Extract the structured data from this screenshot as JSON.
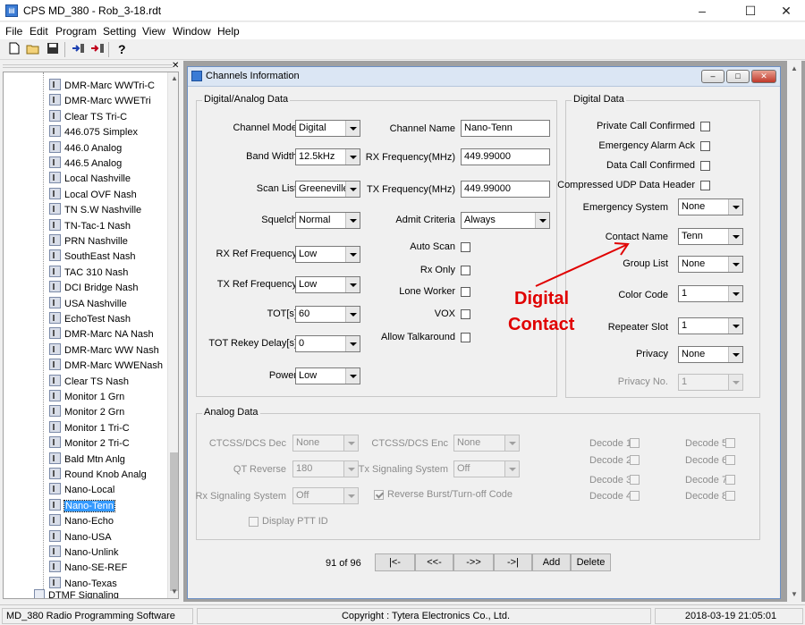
{
  "window": {
    "title": "CPS MD_380 - Rob_3-18.rdt",
    "icon": "cps-app-icon"
  },
  "menu": [
    "File",
    "Edit",
    "Program",
    "Setting",
    "View",
    "Window",
    "Help"
  ],
  "toolbar": {
    "icons": [
      "new-file-icon",
      "open-folder-icon",
      "save-icon",
      "read-radio-icon",
      "write-radio-icon",
      "help-icon"
    ]
  },
  "tree": {
    "items": [
      "DMR-Marc WWTri-C",
      "DMR-Marc WWETri",
      "Clear TS Tri-C",
      "446.075 Simplex",
      "446.0 Analog",
      "446.5 Analog",
      "Local Nashville",
      "Local OVF Nash",
      "TN S.W Nashville",
      "TN-Tac-1 Nash",
      "PRN Nashville",
      "SouthEast Nash",
      "TAC 310 Nash",
      "DCI Bridge Nash",
      "USA Nashville",
      "EchoTest Nash",
      "DMR-Marc NA Nash",
      "DMR-Marc WW Nash",
      "DMR-Marc WWENash",
      "Clear TS Nash",
      "Monitor 1 Grn",
      "Monitor 2 Grn",
      "Monitor 1 Tri-C",
      "Monitor 2 Tri-C",
      "Bald Mtn Anlg",
      "Round Knob Analg",
      "Nano-Local",
      "Nano-Tenn",
      "Nano-Echo",
      "Nano-USA",
      "Nano-Unlink",
      "Nano-SE-REF",
      "Nano-Texas"
    ],
    "selected": "Nano-Tenn",
    "next_group": "DTMF Signaling"
  },
  "child": {
    "title": "Channels Information"
  },
  "digital_analog": {
    "group_title": "Digital/Analog Data",
    "channel_mode": {
      "label": "Channel Mode",
      "value": "Digital"
    },
    "band_width": {
      "label": "Band Width",
      "value": "12.5kHz"
    },
    "scan_list": {
      "label": "Scan List",
      "value": "Greeneville"
    },
    "squelch": {
      "label": "Squelch",
      "value": "Normal"
    },
    "rx_ref": {
      "label": "RX Ref Frequency",
      "value": "Low"
    },
    "tx_ref": {
      "label": "TX Ref Frequency",
      "value": "Low"
    },
    "tot": {
      "label": "TOT[s]",
      "value": "60"
    },
    "tot_rekey": {
      "label": "TOT Rekey Delay[s]",
      "value": "0"
    },
    "power": {
      "label": "Power",
      "value": "Low"
    },
    "channel_name": {
      "label": "Channel Name",
      "value": "Nano-Tenn"
    },
    "rx_freq": {
      "label": "RX Frequency(MHz)",
      "value": "449.99000"
    },
    "tx_freq": {
      "label": "TX Frequency(MHz)",
      "value": "449.99000"
    },
    "admit": {
      "label": "Admit Criteria",
      "value": "Always"
    },
    "auto_scan": {
      "label": "Auto Scan",
      "checked": false
    },
    "rx_only": {
      "label": "Rx Only",
      "checked": false
    },
    "lone_worker": {
      "label": "Lone Worker",
      "checked": false
    },
    "vox": {
      "label": "VOX",
      "checked": false
    },
    "talkaround": {
      "label": "Allow Talkaround",
      "checked": false
    }
  },
  "digital": {
    "group_title": "Digital Data",
    "private_call": {
      "label": "Private Call Confirmed",
      "checked": false
    },
    "emergency_ack": {
      "label": "Emergency Alarm Ack",
      "checked": false
    },
    "data_call": {
      "label": "Data Call Confirmed",
      "checked": false
    },
    "udp_header": {
      "label": "Compressed UDP Data Header",
      "checked": false
    },
    "emergency_system": {
      "label": "Emergency System",
      "value": "None"
    },
    "contact_name": {
      "label": "Contact Name",
      "value": "Tenn"
    },
    "group_list": {
      "label": "Group List",
      "value": "None"
    },
    "color_code": {
      "label": "Color Code",
      "value": "1"
    },
    "repeater_slot": {
      "label": "Repeater Slot",
      "value": "1"
    },
    "privacy": {
      "label": "Privacy",
      "value": "None"
    },
    "privacy_no": {
      "label": "Privacy No.",
      "value": "1"
    }
  },
  "analog": {
    "group_title": "Analog Data",
    "ctcss_dec": {
      "label": "CTCSS/DCS Dec",
      "value": "None"
    },
    "qt_reverse": {
      "label": "QT Reverse",
      "value": "180"
    },
    "rx_signaling": {
      "label": "Rx Signaling System",
      "value": "Off"
    },
    "display_ptt": {
      "label": "Display PTT ID"
    },
    "ctcss_enc": {
      "label": "CTCSS/DCS Enc",
      "value": "None"
    },
    "tx_signaling": {
      "label": "Tx Signaling System",
      "value": "Off"
    },
    "reverse_burst": {
      "label": "Reverse Burst/Turn-off Code",
      "checked": true
    },
    "decodes": [
      "Decode 1",
      "Decode 2",
      "Decode 3",
      "Decode 4",
      "Decode 5",
      "Decode 6",
      "Decode 7",
      "Decode 8"
    ]
  },
  "nav": {
    "position": "91 of 96",
    "first": "|<-",
    "prev": "<<-",
    "next": "->>",
    "last": "->|",
    "add": "Add",
    "delete": "Delete"
  },
  "annotation": {
    "line1": "Digital",
    "line2": "Contact",
    "color": "#e00000"
  },
  "status": {
    "app": "MD_380 Radio Programming Software",
    "copyright": "Copyright : Tytera Electronics Co., Ltd.",
    "datetime": "2018-03-19 21:05:01"
  }
}
